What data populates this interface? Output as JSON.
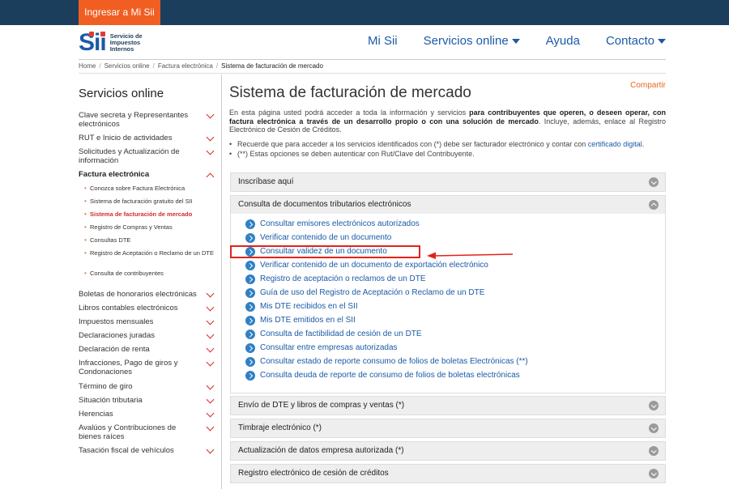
{
  "topbar": {
    "login_label": "Ingresar a Mi Sii"
  },
  "brand": {
    "mark": "Sii",
    "line1": "Servicio de",
    "line2": "Impuestos",
    "line3": "Internos"
  },
  "nav": {
    "mi_sii": "Mi Sii",
    "servicios": "Servicios online",
    "ayuda": "Ayuda",
    "contacto": "Contacto"
  },
  "breadcrumb": [
    "Home",
    "Servicios online",
    "Factura electrónica",
    "Sistema de facturación de mercado"
  ],
  "sidebar": {
    "title": "Servicios online",
    "items": [
      {
        "label": "Clave secreta y Representantes electrónicos"
      },
      {
        "label": "RUT e Inicio de actividades"
      },
      {
        "label": "Solicitudes y Actualización de información"
      },
      {
        "label": "Factura electrónica"
      },
      {
        "label": "Boletas de honorarios electrónicas"
      },
      {
        "label": "Libros contables electrónicos"
      },
      {
        "label": "Impuestos mensuales"
      },
      {
        "label": "Declaraciones juradas"
      },
      {
        "label": "Declaración de renta"
      },
      {
        "label": "Infracciones, Pago de giros y Condonaciones"
      },
      {
        "label": "Término de giro"
      },
      {
        "label": "Situación tributaria"
      },
      {
        "label": "Herencias"
      },
      {
        "label": "Avalúos y Contribuciones de bienes raíces"
      },
      {
        "label": "Tasación fiscal de vehículos"
      }
    ],
    "subitems": [
      {
        "label": "Conozca sobre Factura Electrónica"
      },
      {
        "label": "Sistema de facturación gratuito del SII"
      },
      {
        "label": "Sistema de facturación de mercado"
      },
      {
        "label": "Registro de Compras y Ventas"
      },
      {
        "label": "Consultas DTE"
      },
      {
        "label": "Registro de Aceptación o Reclamo de un DTE"
      },
      {
        "label": "Consulta de contribuyentes"
      }
    ]
  },
  "content": {
    "title": "Sistema de facturación de mercado",
    "share": "Compartir",
    "intro_a": "En esta página usted podrá acceder a toda la información y servicios ",
    "intro_b": "para contribuyentes que operen, o deseen operar, con factura electrónica a través de un desarrollo propio o con una solución de mercado",
    "intro_c": ". Incluye, además, enlace al Registro Electrónico de Cesión de Créditos.",
    "bullet1_a": "Recuerde que para acceder a los servicios identificados con (*) debe ser facturador electrónico y contar con ",
    "bullet1_link": "certificado digital",
    "bullet1_c": ".",
    "bullet2": "(**) Estas opciones se deben autenticar con Rut/Clave del Contribuyente."
  },
  "accordion": [
    {
      "label": "Inscríbase aquí"
    },
    {
      "label": "Consulta de documentos tributarios electrónicos"
    },
    {
      "label": "Envío de DTE y libros de compras y ventas (*)"
    },
    {
      "label": "Timbraje electrónico (*)"
    },
    {
      "label": "Actualización de datos empresa autorizada (*)"
    },
    {
      "label": "Registro electrónico de cesión de créditos"
    }
  ],
  "doc_links": [
    "Consultar emisores electrónicos autorizados",
    "Verificar contenido de un documento",
    "Consultar validez de un documento",
    "Verificar contenido de un documento de exportación electrónico",
    "Registro de aceptación o reclamos de un DTE",
    "Guía de uso del Registro de Aceptación o Reclamo de un DTE",
    "Mis DTE recibidos en el SII",
    "Mis DTE emitidos en el SII",
    "Consulta de factibilidad de cesión de un DTE",
    "Consultar entre empresas autorizadas",
    "Consultar estado de reporte consumo de folios de boletas Electrónicas (**)",
    "Consulta deuda de reporte de consumo de folios de boletas electrónicas"
  ],
  "colors": {
    "topbar": "#1b3e5c",
    "login": "#f15e22",
    "link": "#1b5aa6",
    "accent_red": "#d62b2b",
    "highlight": "#e2231a"
  }
}
